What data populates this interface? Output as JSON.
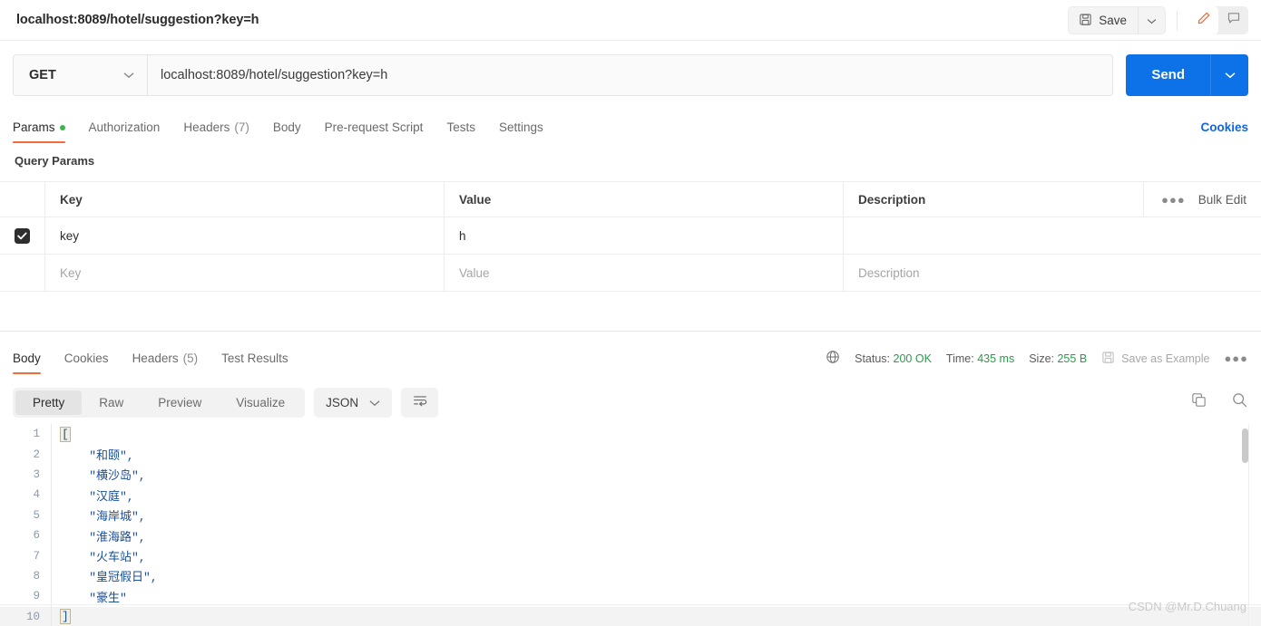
{
  "topbar": {
    "request_title": "localhost:8089/hotel/suggestion?key=h",
    "save_label": "Save",
    "save_icon": "floppy-disk-icon",
    "save_caret_icon": "chevron-down-icon",
    "edit_icon": "pencil-icon",
    "comment_icon": "comment-icon",
    "accent_orange": "#f26b3a"
  },
  "url_row": {
    "method": "GET",
    "method_caret_icon": "chevron-down-icon",
    "url": "localhost:8089/hotel/suggestion?key=h",
    "send_label": "Send",
    "send_caret_icon": "chevron-down-icon",
    "send_color": "#0d72e8"
  },
  "request_tabs": {
    "items": [
      {
        "label": "Params",
        "active": true,
        "dot": true
      },
      {
        "label": "Authorization",
        "active": false
      },
      {
        "label": "Headers",
        "count": "(7)",
        "active": false
      },
      {
        "label": "Body",
        "active": false
      },
      {
        "label": "Pre-request Script",
        "active": false
      },
      {
        "label": "Tests",
        "active": false
      },
      {
        "label": "Settings",
        "active": false
      }
    ],
    "cookies_link": "Cookies"
  },
  "query_params": {
    "section_title": "Query Params",
    "headers": {
      "key": "Key",
      "value": "Value",
      "description": "Description"
    },
    "bulk_more_icon": "ellipsis-icon",
    "bulk_edit_label": "Bulk Edit",
    "rows": [
      {
        "checked": true,
        "key": "key",
        "value": "h",
        "description": ""
      }
    ],
    "placeholder_row": {
      "key": "Key",
      "value": "Value",
      "description": "Description"
    }
  },
  "response_tabs": {
    "items": [
      {
        "label": "Body",
        "active": true
      },
      {
        "label": "Cookies",
        "active": false
      },
      {
        "label": "Headers",
        "count": "(5)",
        "active": false
      },
      {
        "label": "Test Results",
        "active": false
      }
    ],
    "globe_icon": "globe-icon",
    "status_label": "Status:",
    "status_value": "200 OK",
    "time_label": "Time:",
    "time_value": "435 ms",
    "size_label": "Size:",
    "size_value": "255 B",
    "save_example_label": "Save as Example",
    "save_example_icon": "floppy-disk-icon",
    "more_icon": "ellipsis-icon",
    "status_color": "#2a9a4a"
  },
  "body_toolbar": {
    "view_modes": [
      {
        "label": "Pretty",
        "active": true
      },
      {
        "label": "Raw",
        "active": false
      },
      {
        "label": "Preview",
        "active": false
      },
      {
        "label": "Visualize",
        "active": false
      }
    ],
    "format": "JSON",
    "format_caret_icon": "chevron-down-icon",
    "wrap_icon": "wrap-lines-icon",
    "copy_icon": "copy-icon",
    "search_icon": "search-icon"
  },
  "response_body": {
    "lines": [
      {
        "number": "1",
        "bracket": "[",
        "text": ""
      },
      {
        "number": "2",
        "text": "    \"和颐\","
      },
      {
        "number": "3",
        "text": "    \"横沙岛\","
      },
      {
        "number": "4",
        "text": "    \"汉庭\","
      },
      {
        "number": "5",
        "text": "    \"海岸城\","
      },
      {
        "number": "6",
        "text": "    \"淮海路\","
      },
      {
        "number": "7",
        "text": "    \"火车站\","
      },
      {
        "number": "8",
        "text": "    \"皇冠假日\","
      },
      {
        "number": "9",
        "text": "    \"豪生\""
      },
      {
        "number": "10",
        "bracket": "]",
        "text": "",
        "current": true
      }
    ]
  },
  "watermark": {
    "text": "CSDN @Mr.D.Chuang"
  }
}
